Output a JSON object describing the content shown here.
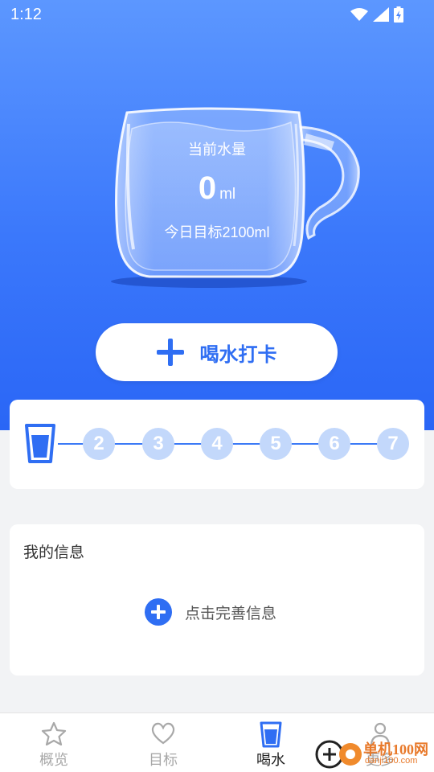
{
  "status": {
    "time": "1:12"
  },
  "cup": {
    "label": "当前水量",
    "amount": "0",
    "unit": "ml",
    "goal": "今日目标2100ml"
  },
  "checkin": {
    "label": "喝水打卡"
  },
  "progress": {
    "days": [
      "2",
      "3",
      "4",
      "5",
      "6",
      "7"
    ]
  },
  "info": {
    "title": "我的信息",
    "action": "点击完善信息"
  },
  "tabs": [
    {
      "label": "概览",
      "icon": "star-icon"
    },
    {
      "label": "目标",
      "icon": "heart-icon"
    },
    {
      "label": "喝水",
      "icon": "water-cup-icon"
    },
    {
      "label": "更多",
      "icon": "person-icon"
    }
  ],
  "watermark": {
    "text": "单机100网",
    "sub": "danji100.com"
  },
  "colors": {
    "primary": "#2f6ef3",
    "hero_top": "#5c97ff",
    "hero_bottom": "#2a66f6"
  }
}
